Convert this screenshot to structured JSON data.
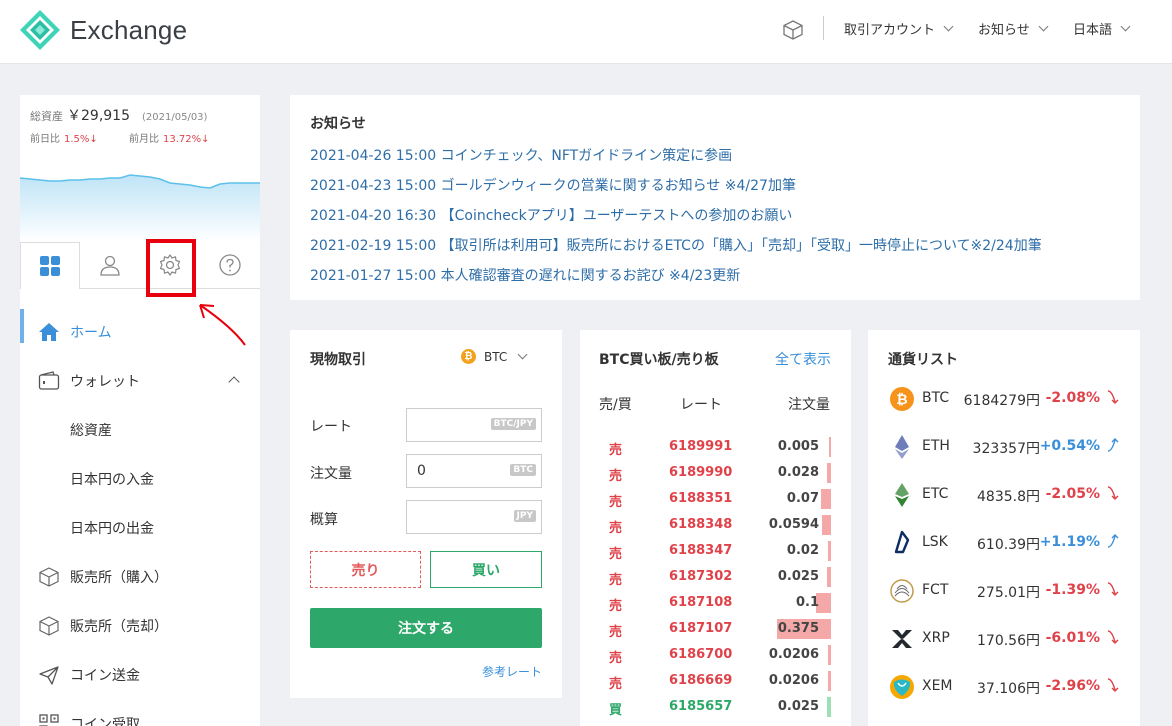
{
  "header": {
    "app_name": "Exchange",
    "menu": [
      {
        "label": "取引アカウント"
      },
      {
        "label": "お知らせ"
      },
      {
        "label": "日本語"
      }
    ]
  },
  "sidebar": {
    "asset_label": "総資産",
    "asset_value": "￥29,915",
    "asset_date": "(2021/05/03)",
    "day_change_label": "前日比",
    "day_change_value": "1.5%↓",
    "month_change_label": "前月比",
    "month_change_value": "13.72%↓",
    "tabs": [
      "dashboard-icon",
      "user-icon",
      "gear-icon",
      "help-icon"
    ],
    "nav": [
      {
        "label": "ホーム",
        "icon": "home-icon",
        "active": true
      },
      {
        "label": "ウォレット",
        "icon": "wallet-icon",
        "expanded": true
      },
      {
        "label": "総資産",
        "sub": true
      },
      {
        "label": "日本円の入金",
        "sub": true
      },
      {
        "label": "日本円の出金",
        "sub": true
      },
      {
        "label": "販売所（購入）",
        "icon": "cube-icon"
      },
      {
        "label": "販売所（売却）",
        "icon": "cube-icon"
      },
      {
        "label": "コイン送金",
        "icon": "send-icon"
      },
      {
        "label": "コイン受取",
        "icon": "qr-icon"
      }
    ]
  },
  "news": {
    "title": "お知らせ",
    "items": [
      "2021-04-26 15:00 コインチェック、NFTガイドライン策定に参画",
      "2021-04-23 15:00 ゴールデンウィークの営業に関するお知らせ ※4/27加筆",
      "2021-04-20 16:30 【Coincheckアプリ】ユーザーテストへの参加のお願い",
      "2021-02-19 15:00 【取引所は利用可】販売所におけるETCの「購入」「売却」「受取」一時停止について※2/24加筆",
      "2021-01-27 15:00 本人確認審査の遅れに関するお詫び ※4/23更新"
    ]
  },
  "trade": {
    "title": "現物取引",
    "coin": "BTC",
    "coin_glyph": "₿",
    "rate_label": "レート",
    "rate_unit": "BTC/JPY",
    "qty_label": "注文量",
    "qty_value": "0",
    "qty_unit": "BTC",
    "est_label": "概算",
    "est_unit": "JPY",
    "sell_label": "売り",
    "buy_label": "買い",
    "order_label": "注文する",
    "ref_label": "参考レート"
  },
  "book": {
    "title": "BTC買い板/売り板",
    "show_all": "全て表示",
    "col_side": "売/買",
    "col_rate": "レート",
    "col_amount": "注文量",
    "rows": [
      {
        "side": "売",
        "rate": "6189991",
        "amount": "0.005",
        "depth": 0.01
      },
      {
        "side": "売",
        "rate": "6189990",
        "amount": "0.028",
        "depth": 0.07
      },
      {
        "side": "売",
        "rate": "6188351",
        "amount": "0.07",
        "depth": 0.19
      },
      {
        "side": "売",
        "rate": "6188348",
        "amount": "0.0594",
        "depth": 0.16
      },
      {
        "side": "売",
        "rate": "6188347",
        "amount": "0.02",
        "depth": 0.05
      },
      {
        "side": "売",
        "rate": "6187302",
        "amount": "0.025",
        "depth": 0.07
      },
      {
        "side": "売",
        "rate": "6187108",
        "amount": "0.1",
        "depth": 0.27
      },
      {
        "side": "売",
        "rate": "6187107",
        "amount": "0.375",
        "depth": 1.0
      },
      {
        "side": "売",
        "rate": "6186700",
        "amount": "0.0206",
        "depth": 0.05
      },
      {
        "side": "売",
        "rate": "6186669",
        "amount": "0.0206",
        "depth": 0.05
      },
      {
        "side": "買",
        "rate": "6185657",
        "amount": "0.025",
        "depth": 0.07
      }
    ]
  },
  "currencies": {
    "title": "通貨リスト",
    "items": [
      {
        "sym": "BTC",
        "price": "6184279円",
        "pct": "-2.08%",
        "dir": "down",
        "icon": "btc-icon",
        "color": "#f7931a"
      },
      {
        "sym": "ETH",
        "price": "323357円",
        "pct": "+0.54%",
        "dir": "up",
        "icon": "eth-icon",
        "color": "#6f7cba"
      },
      {
        "sym": "ETC",
        "price": "4835.8円",
        "pct": "-2.05%",
        "dir": "down",
        "icon": "etc-icon",
        "color": "#328332"
      },
      {
        "sym": "LSK",
        "price": "610.39円",
        "pct": "+1.19%",
        "dir": "up",
        "icon": "lsk-icon",
        "color": "#0d2e64"
      },
      {
        "sym": "FCT",
        "price": "275.01円",
        "pct": "-1.39%",
        "dir": "down",
        "icon": "fct-icon",
        "color": "#c29a4c"
      },
      {
        "sym": "XRP",
        "price": "170.56円",
        "pct": "-6.01%",
        "dir": "down",
        "icon": "xrp-icon",
        "color": "#23292f"
      },
      {
        "sym": "XEM",
        "price": "37.106円",
        "pct": "-2.96%",
        "dir": "down",
        "icon": "xem-icon",
        "color": "#2ab9c4"
      }
    ]
  },
  "colors": {
    "accent": "#3a8fd8",
    "sell": "#e0424a",
    "buy": "#2ea86a",
    "highlight": "#e8000e"
  }
}
